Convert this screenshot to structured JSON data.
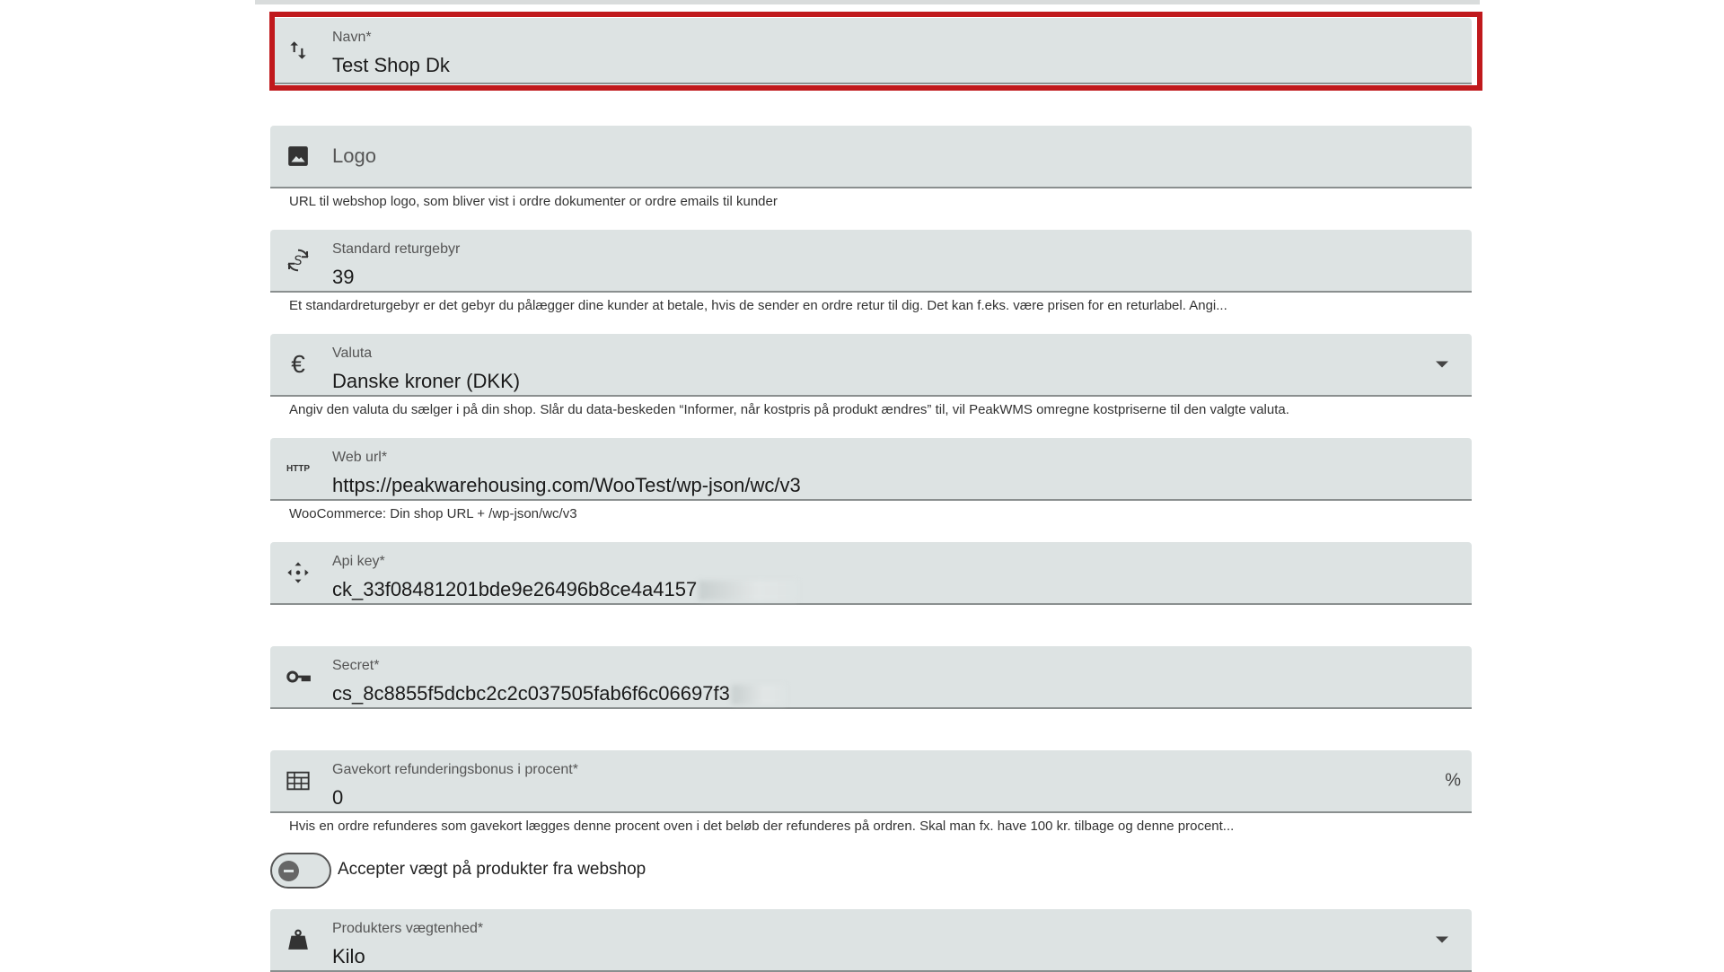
{
  "fields": {
    "navn": {
      "label": "Navn*",
      "value": "Test Shop Dk",
      "icon": "sort-arrows-icon"
    },
    "logo": {
      "placeholder": "Logo",
      "helper": "URL til webshop logo, som bliver vist i ordre dokumenter or ordre emails til kunder",
      "icon": "image-icon"
    },
    "return_fee": {
      "label": "Standard returgebyr",
      "value": "39",
      "helper": "Et standardreturgebyr er det gebyr du pålægger dine kunder at betale, hvis de sender en ordre retur til dig. Det kan f.eks. være prisen for en returlabel. Angi...",
      "icon": "currency-exchange-icon"
    },
    "currency": {
      "label": "Valuta",
      "value": "Danske kroner (DKK)",
      "helper": "Angiv den valuta du sælger i på din shop. Slår du data-beskeden “Informer, når kostpris på produkt ændres” til, vil PeakWMS omregne kostpriserne til den valgte valuta.",
      "icon": "euro-icon",
      "icon_glyph": "€"
    },
    "web_url": {
      "label": "Web url*",
      "value": "https://peakwarehousing.com/WooTest/wp-json/wc/v3",
      "helper": "WooCommerce: Din shop URL + /wp-json/wc/v3",
      "icon": "http-icon",
      "icon_text": "HTTP"
    },
    "api_key": {
      "label": "Api key*",
      "value": "ck_33f08481201bde9e26496b8ce4a4157",
      "icon": "move-arrows-icon"
    },
    "secret": {
      "label": "Secret*",
      "value": "cs_8c8855f5dcbc2c2c037505fab6f6c06697f3",
      "icon": "key-icon"
    },
    "giftcard_bonus": {
      "label": "Gavekort refunderingsbonus i procent*",
      "value": "0",
      "suffix": "%",
      "helper": "Hvis en ordre refunderes som gavekort lægges denne procent oven i det beløb der refunderes på ordren. Skal man fx. have 100 kr. tilbage og denne procent...",
      "icon": "calendar-grid-icon"
    },
    "weight_unit": {
      "label": "Produkters vægtenhed*",
      "value": "Kilo",
      "icon": "weight-icon"
    }
  },
  "toggle": {
    "label": "Accepter vægt på produkter fra webshop",
    "checked": false
  },
  "colors": {
    "field_bg": "#dde3e3",
    "highlight": "#c0191c"
  }
}
